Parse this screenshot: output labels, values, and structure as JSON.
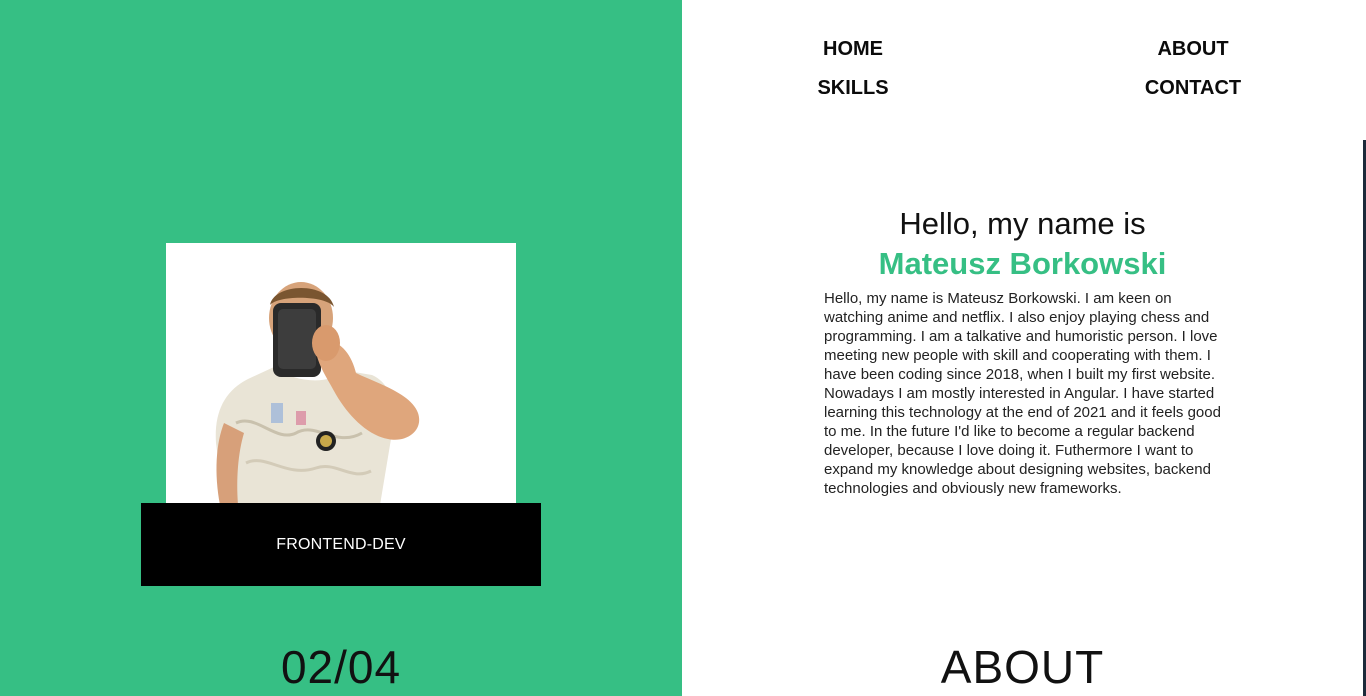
{
  "nav": {
    "home": "HOME",
    "about": "ABOUT",
    "skills": "SKILLS",
    "contact": "CONTACT"
  },
  "hero": {
    "role": "FRONTEND-DEV",
    "counter": "02/04"
  },
  "about": {
    "greeting": "Hello, my name is",
    "name": "Mateusz Borkowski",
    "paragraph1": "Hello, my name is Mateusz Borkowski. I am keen on watching anime and netflix. I also enjoy playing chess and programming. I am a talkative and humoristic person. I love meeting new people with skill and cooperating with them. I have been coding since 2018, when I built my first website.",
    "paragraph2": "Nowadays I am mostly interested in Angular. I have started learning this technology at the end of 2021 and it feels good to me. In the future I'd like to become a regular backend developer, because I love doing it. Futhermore I want to expand my knowledge about designing websites, backend technologies and obviously new frameworks.",
    "section_title": "ABOUT"
  },
  "colors": {
    "accent": "#36bf84",
    "dark": "#000000",
    "background": "#ffffff"
  }
}
